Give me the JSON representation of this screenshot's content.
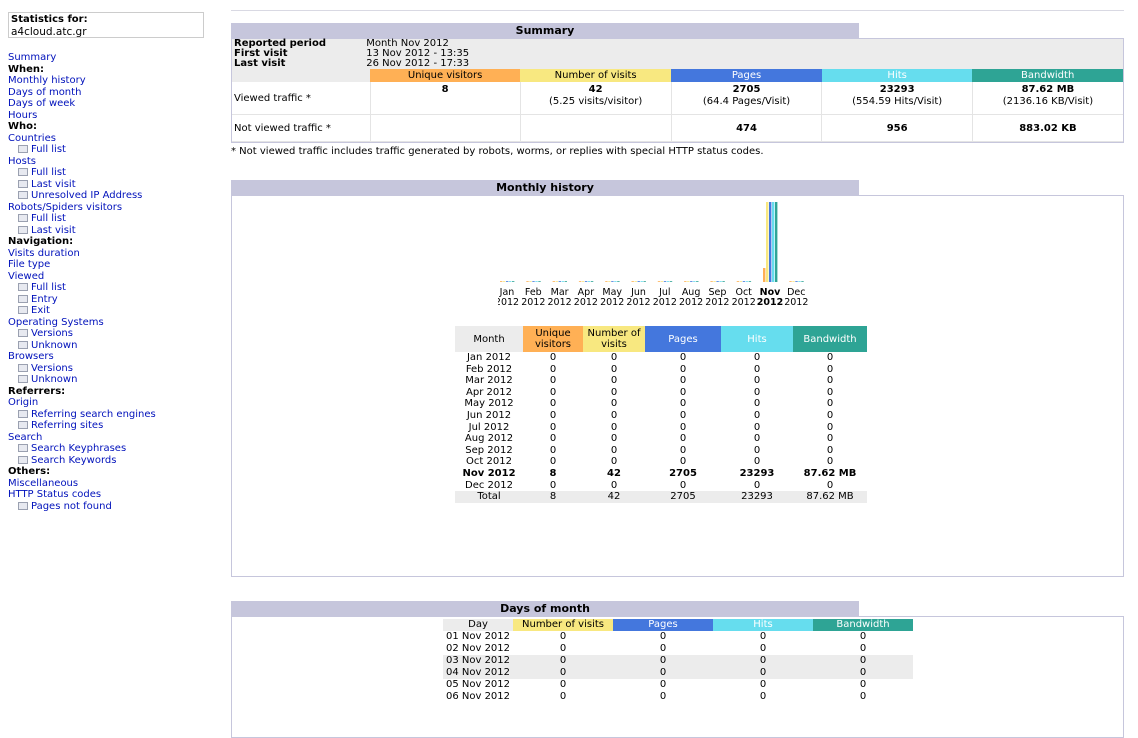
{
  "sidebar": {
    "stats_for_label": "Statistics for:",
    "site": "a4cloud.atc.gr",
    "items": [
      {
        "text": "Summary",
        "type": "link"
      },
      {
        "text": "When:",
        "type": "head"
      },
      {
        "text": "Monthly history",
        "type": "link"
      },
      {
        "text": "Days of month",
        "type": "link"
      },
      {
        "text": "Days of week",
        "type": "link"
      },
      {
        "text": "Hours",
        "type": "link"
      },
      {
        "text": "Who:",
        "type": "head"
      },
      {
        "text": "Countries",
        "type": "link"
      },
      {
        "text": "Full list",
        "type": "sub"
      },
      {
        "text": "Hosts",
        "type": "link"
      },
      {
        "text": "Full list",
        "type": "sub"
      },
      {
        "text": "Last visit",
        "type": "sub"
      },
      {
        "text": "Unresolved IP Address",
        "type": "sub"
      },
      {
        "text": "Robots/Spiders visitors",
        "type": "link"
      },
      {
        "text": "Full list",
        "type": "sub"
      },
      {
        "text": "Last visit",
        "type": "sub"
      },
      {
        "text": "Navigation:",
        "type": "head"
      },
      {
        "text": "Visits duration",
        "type": "link"
      },
      {
        "text": "File type",
        "type": "link"
      },
      {
        "text": "Viewed",
        "type": "link"
      },
      {
        "text": "Full list",
        "type": "sub"
      },
      {
        "text": "Entry",
        "type": "sub"
      },
      {
        "text": "Exit",
        "type": "sub"
      },
      {
        "text": "Operating Systems",
        "type": "link"
      },
      {
        "text": "Versions",
        "type": "sub"
      },
      {
        "text": "Unknown",
        "type": "sub"
      },
      {
        "text": "Browsers",
        "type": "link"
      },
      {
        "text": "Versions",
        "type": "sub"
      },
      {
        "text": "Unknown",
        "type": "sub"
      },
      {
        "text": "Referrers:",
        "type": "head"
      },
      {
        "text": "Origin",
        "type": "link"
      },
      {
        "text": "Referring search engines",
        "type": "sub"
      },
      {
        "text": "Referring sites",
        "type": "sub"
      },
      {
        "text": "Search",
        "type": "link"
      },
      {
        "text": "Search Keyphrases",
        "type": "sub"
      },
      {
        "text": "Search Keywords",
        "type": "sub"
      },
      {
        "text": "Others:",
        "type": "head"
      },
      {
        "text": "Miscellaneous",
        "type": "link"
      },
      {
        "text": "HTTP Status codes",
        "type": "link"
      },
      {
        "text": "Pages not found",
        "type": "sub"
      }
    ]
  },
  "colors": {
    "unique_visitors": "#ffb055",
    "visits": "#f8e880",
    "pages": "#4477dd",
    "hits": "#66ddee",
    "bandwidth": "#2ea495"
  },
  "summary": {
    "title": "Summary",
    "reported_period_label": "Reported period",
    "reported_period": "Month Nov 2012",
    "first_visit_label": "First visit",
    "first_visit": "13 Nov 2012 - 13:35",
    "last_visit_label": "Last visit",
    "last_visit": "26 Nov 2012 - 17:33",
    "headers": {
      "unique_visitors": "Unique visitors",
      "visits": "Number of visits",
      "pages": "Pages",
      "hits": "Hits",
      "bandwidth": "Bandwidth"
    },
    "viewed": {
      "label": "Viewed traffic *",
      "unique_visitors": "8",
      "visits": "42",
      "visits_sub": "(5.25 visits/visitor)",
      "pages": "2705",
      "pages_sub": "(64.4 Pages/Visit)",
      "hits": "23293",
      "hits_sub": "(554.59 Hits/Visit)",
      "bandwidth": "87.62 MB",
      "bandwidth_sub": "(2136.16 KB/Visit)"
    },
    "not_viewed": {
      "label": "Not viewed traffic *",
      "pages": "474",
      "hits": "956",
      "bandwidth": "883.02 KB"
    },
    "note": "* Not viewed traffic includes traffic generated by robots, worms, or replies with special HTTP status codes."
  },
  "monthly": {
    "title": "Monthly history",
    "headers": {
      "month": "Month",
      "unique_visitors": "Unique visitors",
      "visits": "Number of visits",
      "pages": "Pages",
      "hits": "Hits",
      "bandwidth": "Bandwidth"
    },
    "rows": [
      {
        "month": "Jan 2012",
        "uv": "0",
        "v": "0",
        "p": "0",
        "h": "0",
        "b": "0"
      },
      {
        "month": "Feb 2012",
        "uv": "0",
        "v": "0",
        "p": "0",
        "h": "0",
        "b": "0"
      },
      {
        "month": "Mar 2012",
        "uv": "0",
        "v": "0",
        "p": "0",
        "h": "0",
        "b": "0"
      },
      {
        "month": "Apr 2012",
        "uv": "0",
        "v": "0",
        "p": "0",
        "h": "0",
        "b": "0"
      },
      {
        "month": "May 2012",
        "uv": "0",
        "v": "0",
        "p": "0",
        "h": "0",
        "b": "0"
      },
      {
        "month": "Jun 2012",
        "uv": "0",
        "v": "0",
        "p": "0",
        "h": "0",
        "b": "0"
      },
      {
        "month": "Jul 2012",
        "uv": "0",
        "v": "0",
        "p": "0",
        "h": "0",
        "b": "0"
      },
      {
        "month": "Aug 2012",
        "uv": "0",
        "v": "0",
        "p": "0",
        "h": "0",
        "b": "0"
      },
      {
        "month": "Sep 2012",
        "uv": "0",
        "v": "0",
        "p": "0",
        "h": "0",
        "b": "0"
      },
      {
        "month": "Oct 2012",
        "uv": "0",
        "v": "0",
        "p": "0",
        "h": "0",
        "b": "0"
      },
      {
        "month": "Nov 2012",
        "uv": "8",
        "v": "42",
        "p": "2705",
        "h": "23293",
        "b": "87.62 MB",
        "bold": true
      },
      {
        "month": "Dec 2012",
        "uv": "0",
        "v": "0",
        "p": "0",
        "h": "0",
        "b": "0"
      }
    ],
    "total": {
      "month": "Total",
      "uv": "8",
      "v": "42",
      "p": "2705",
      "h": "23293",
      "b": "87.62 MB"
    }
  },
  "chart_data": {
    "type": "bar",
    "categories": [
      "Jan",
      "Feb",
      "Mar",
      "Apr",
      "May",
      "Jun",
      "Jul",
      "Aug",
      "Sep",
      "Oct",
      "Nov",
      "Dec"
    ],
    "category_years": [
      "2012",
      "2012",
      "2012",
      "2012",
      "2012",
      "2012",
      "2012",
      "2012",
      "2012",
      "2012",
      "2012",
      "2012"
    ],
    "highlight": "Nov",
    "series": [
      {
        "name": "Unique visitors",
        "color": "#ffb055",
        "values": [
          0,
          0,
          0,
          0,
          0,
          0,
          0,
          0,
          0,
          0,
          8,
          0
        ]
      },
      {
        "name": "Number of visits",
        "color": "#f8e880",
        "values": [
          0,
          0,
          0,
          0,
          0,
          0,
          0,
          0,
          0,
          0,
          42,
          0
        ]
      },
      {
        "name": "Pages",
        "color": "#4477dd",
        "values": [
          0,
          0,
          0,
          0,
          0,
          0,
          0,
          0,
          0,
          0,
          2705,
          0
        ]
      },
      {
        "name": "Hits",
        "color": "#66ddee",
        "values": [
          0,
          0,
          0,
          0,
          0,
          0,
          0,
          0,
          0,
          0,
          23293,
          0
        ]
      },
      {
        "name": "Bandwidth (MB)",
        "color": "#2ea495",
        "values": [
          0,
          0,
          0,
          0,
          0,
          0,
          0,
          0,
          0,
          0,
          87.62,
          0
        ]
      }
    ]
  },
  "days": {
    "title": "Days of month",
    "headers": {
      "day": "Day",
      "visits": "Number of visits",
      "pages": "Pages",
      "hits": "Hits",
      "bandwidth": "Bandwidth"
    },
    "rows": [
      {
        "day": "01 Nov 2012",
        "v": "0",
        "p": "0",
        "h": "0",
        "b": "0"
      },
      {
        "day": "02 Nov 2012",
        "v": "0",
        "p": "0",
        "h": "0",
        "b": "0"
      },
      {
        "day": "03 Nov 2012",
        "v": "0",
        "p": "0",
        "h": "0",
        "b": "0",
        "shade": true
      },
      {
        "day": "04 Nov 2012",
        "v": "0",
        "p": "0",
        "h": "0",
        "b": "0",
        "shade": true
      },
      {
        "day": "05 Nov 2012",
        "v": "0",
        "p": "0",
        "h": "0",
        "b": "0"
      },
      {
        "day": "06 Nov 2012",
        "v": "0",
        "p": "0",
        "h": "0",
        "b": "0"
      }
    ]
  }
}
